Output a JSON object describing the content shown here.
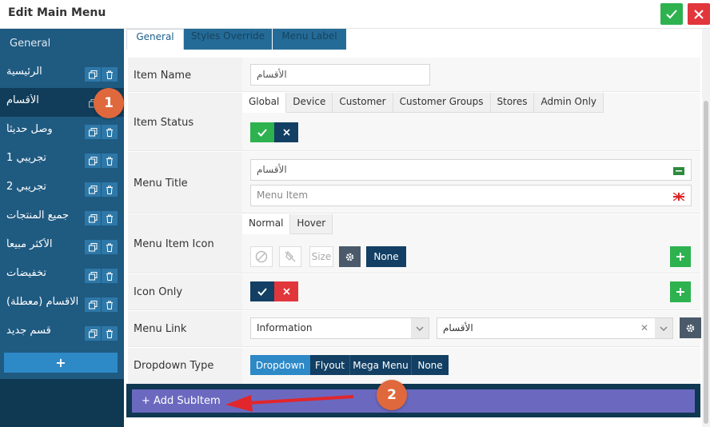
{
  "window": {
    "title": "Edit Main Menu"
  },
  "colors": {
    "accent": "#1f5a81",
    "success": "#2eb24f",
    "danger": "#e1363c",
    "arrow": "#e1262c",
    "badge": "#e0683d",
    "addsub": "#6b69bf"
  },
  "sidebar": {
    "general_label": "General",
    "items": [
      {
        "label": "الرئيسية"
      },
      {
        "label": "الأقسام"
      },
      {
        "label": "وصل حديثاً"
      },
      {
        "label": "تجريبي 1"
      },
      {
        "label": "تجريبي 2"
      },
      {
        "label": "جميع المنتجات"
      },
      {
        "label": "الأكثر مبيعاً"
      },
      {
        "label": "تخفيضات"
      },
      {
        "label": "ح الاقسام (معطلة)"
      },
      {
        "label": "قسم جديد"
      }
    ],
    "add_label": "+"
  },
  "tabs": [
    "General",
    "Styles Override",
    "Menu Label"
  ],
  "form": {
    "item_name": {
      "label": "Item Name",
      "value": "الأقسام"
    },
    "item_status": {
      "label": "Item Status",
      "tabs": [
        "Global",
        "Device",
        "Customer",
        "Customer Groups",
        "Stores",
        "Admin Only"
      ]
    },
    "menu_title": {
      "label": "Menu Title",
      "value": "الأقسام",
      "placeholder": "Menu Item"
    },
    "menu_item_icon": {
      "label": "Menu Item Icon",
      "tabs": [
        "Normal",
        "Hover"
      ],
      "size_placeholder": "Size",
      "none_label": "None"
    },
    "icon_only": {
      "label": "Icon Only"
    },
    "menu_link": {
      "label": "Menu Link",
      "type_value": "Information",
      "target_value": "الأقسام"
    },
    "dropdown_type": {
      "label": "Dropdown Type",
      "options": [
        "Dropdown",
        "Flyout",
        "Mega Menu",
        "None"
      ]
    }
  },
  "add_subitem_label": "+ Add SubItem",
  "badges": [
    "1",
    "2"
  ]
}
